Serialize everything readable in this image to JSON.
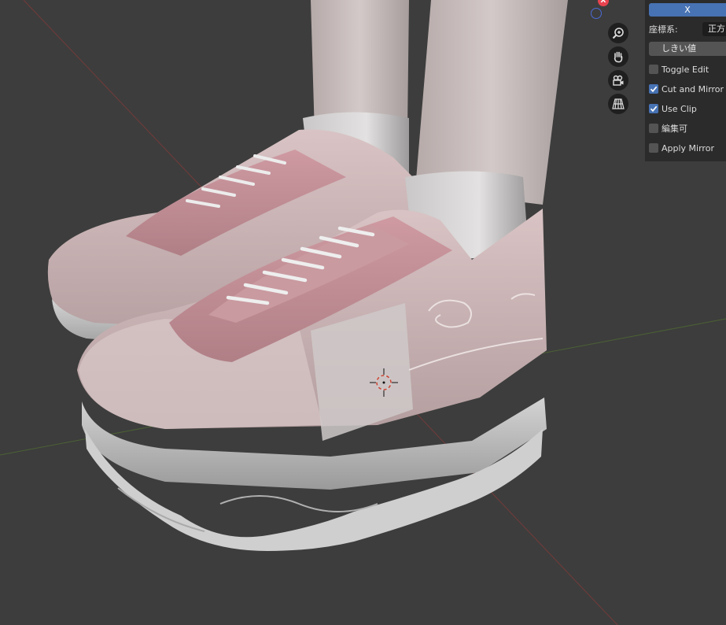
{
  "viewport": {
    "scene_description_icon": "3d-viewport-shoes-model",
    "gizmo": {
      "x_axis_label": "X",
      "x_color": "#e8434f",
      "z_ring_color": "#4a6bd6"
    },
    "nav_icons": [
      "zoom-icon",
      "pan-hand-icon",
      "camera-icon",
      "perspective-grid-icon"
    ]
  },
  "panel": {
    "axis_button": "X",
    "coordinate_label": "座標系:",
    "coordinate_value": "正方",
    "threshold_button": "しきい値",
    "options": [
      {
        "label": "Toggle Edit",
        "checked": false
      },
      {
        "label": "Cut and Mirror",
        "checked": true
      },
      {
        "label": "Use Clip",
        "checked": true
      },
      {
        "label": "編集可",
        "checked": false
      },
      {
        "label": "Apply Mirror",
        "checked": false
      }
    ],
    "accent_color": "#4772b3"
  }
}
